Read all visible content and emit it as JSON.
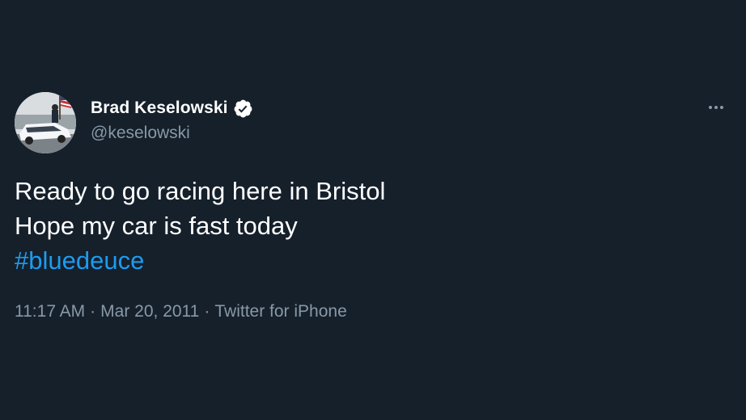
{
  "user": {
    "display_name": "Brad Keselowski",
    "handle": "@keselowski",
    "verified_icon": "verified-badge-icon",
    "avatar_icon": "avatar-photo"
  },
  "tweet": {
    "lines": [
      "Ready to go racing here in Bristol",
      "Hope my car is fast today"
    ],
    "hashtag": "#bluedeuce"
  },
  "meta": {
    "time": "11:17 AM",
    "separator": "·",
    "date": "Mar 20, 2011",
    "source": "Twitter for iPhone"
  },
  "menu": {
    "icon": "more-options-icon"
  },
  "colors": {
    "background": "#15202b",
    "text": "#ffffff",
    "secondary_text": "#8899a6",
    "hashtag": "#1d9bf0"
  }
}
